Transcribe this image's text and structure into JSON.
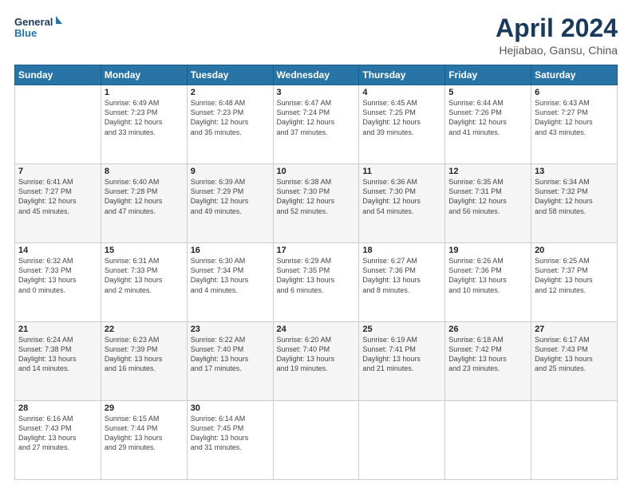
{
  "header": {
    "logo_line1": "General",
    "logo_line2": "Blue",
    "title": "April 2024",
    "subtitle": "Hejiabao, Gansu, China"
  },
  "weekdays": [
    "Sunday",
    "Monday",
    "Tuesday",
    "Wednesday",
    "Thursday",
    "Friday",
    "Saturday"
  ],
  "weeks": [
    [
      {
        "day": "",
        "info": ""
      },
      {
        "day": "1",
        "info": "Sunrise: 6:49 AM\nSunset: 7:23 PM\nDaylight: 12 hours\nand 33 minutes."
      },
      {
        "day": "2",
        "info": "Sunrise: 6:48 AM\nSunset: 7:23 PM\nDaylight: 12 hours\nand 35 minutes."
      },
      {
        "day": "3",
        "info": "Sunrise: 6:47 AM\nSunset: 7:24 PM\nDaylight: 12 hours\nand 37 minutes."
      },
      {
        "day": "4",
        "info": "Sunrise: 6:45 AM\nSunset: 7:25 PM\nDaylight: 12 hours\nand 39 minutes."
      },
      {
        "day": "5",
        "info": "Sunrise: 6:44 AM\nSunset: 7:26 PM\nDaylight: 12 hours\nand 41 minutes."
      },
      {
        "day": "6",
        "info": "Sunrise: 6:43 AM\nSunset: 7:27 PM\nDaylight: 12 hours\nand 43 minutes."
      }
    ],
    [
      {
        "day": "7",
        "info": "Sunrise: 6:41 AM\nSunset: 7:27 PM\nDaylight: 12 hours\nand 45 minutes."
      },
      {
        "day": "8",
        "info": "Sunrise: 6:40 AM\nSunset: 7:28 PM\nDaylight: 12 hours\nand 47 minutes."
      },
      {
        "day": "9",
        "info": "Sunrise: 6:39 AM\nSunset: 7:29 PM\nDaylight: 12 hours\nand 49 minutes."
      },
      {
        "day": "10",
        "info": "Sunrise: 6:38 AM\nSunset: 7:30 PM\nDaylight: 12 hours\nand 52 minutes."
      },
      {
        "day": "11",
        "info": "Sunrise: 6:36 AM\nSunset: 7:30 PM\nDaylight: 12 hours\nand 54 minutes."
      },
      {
        "day": "12",
        "info": "Sunrise: 6:35 AM\nSunset: 7:31 PM\nDaylight: 12 hours\nand 56 minutes."
      },
      {
        "day": "13",
        "info": "Sunrise: 6:34 AM\nSunset: 7:32 PM\nDaylight: 12 hours\nand 58 minutes."
      }
    ],
    [
      {
        "day": "14",
        "info": "Sunrise: 6:32 AM\nSunset: 7:33 PM\nDaylight: 13 hours\nand 0 minutes."
      },
      {
        "day": "15",
        "info": "Sunrise: 6:31 AM\nSunset: 7:33 PM\nDaylight: 13 hours\nand 2 minutes."
      },
      {
        "day": "16",
        "info": "Sunrise: 6:30 AM\nSunset: 7:34 PM\nDaylight: 13 hours\nand 4 minutes."
      },
      {
        "day": "17",
        "info": "Sunrise: 6:29 AM\nSunset: 7:35 PM\nDaylight: 13 hours\nand 6 minutes."
      },
      {
        "day": "18",
        "info": "Sunrise: 6:27 AM\nSunset: 7:36 PM\nDaylight: 13 hours\nand 8 minutes."
      },
      {
        "day": "19",
        "info": "Sunrise: 6:26 AM\nSunset: 7:36 PM\nDaylight: 13 hours\nand 10 minutes."
      },
      {
        "day": "20",
        "info": "Sunrise: 6:25 AM\nSunset: 7:37 PM\nDaylight: 13 hours\nand 12 minutes."
      }
    ],
    [
      {
        "day": "21",
        "info": "Sunrise: 6:24 AM\nSunset: 7:38 PM\nDaylight: 13 hours\nand 14 minutes."
      },
      {
        "day": "22",
        "info": "Sunrise: 6:23 AM\nSunset: 7:39 PM\nDaylight: 13 hours\nand 16 minutes."
      },
      {
        "day": "23",
        "info": "Sunrise: 6:22 AM\nSunset: 7:40 PM\nDaylight: 13 hours\nand 17 minutes."
      },
      {
        "day": "24",
        "info": "Sunrise: 6:20 AM\nSunset: 7:40 PM\nDaylight: 13 hours\nand 19 minutes."
      },
      {
        "day": "25",
        "info": "Sunrise: 6:19 AM\nSunset: 7:41 PM\nDaylight: 13 hours\nand 21 minutes."
      },
      {
        "day": "26",
        "info": "Sunrise: 6:18 AM\nSunset: 7:42 PM\nDaylight: 13 hours\nand 23 minutes."
      },
      {
        "day": "27",
        "info": "Sunrise: 6:17 AM\nSunset: 7:43 PM\nDaylight: 13 hours\nand 25 minutes."
      }
    ],
    [
      {
        "day": "28",
        "info": "Sunrise: 6:16 AM\nSunset: 7:43 PM\nDaylight: 13 hours\nand 27 minutes."
      },
      {
        "day": "29",
        "info": "Sunrise: 6:15 AM\nSunset: 7:44 PM\nDaylight: 13 hours\nand 29 minutes."
      },
      {
        "day": "30",
        "info": "Sunrise: 6:14 AM\nSunset: 7:45 PM\nDaylight: 13 hours\nand 31 minutes."
      },
      {
        "day": "",
        "info": ""
      },
      {
        "day": "",
        "info": ""
      },
      {
        "day": "",
        "info": ""
      },
      {
        "day": "",
        "info": ""
      }
    ]
  ]
}
